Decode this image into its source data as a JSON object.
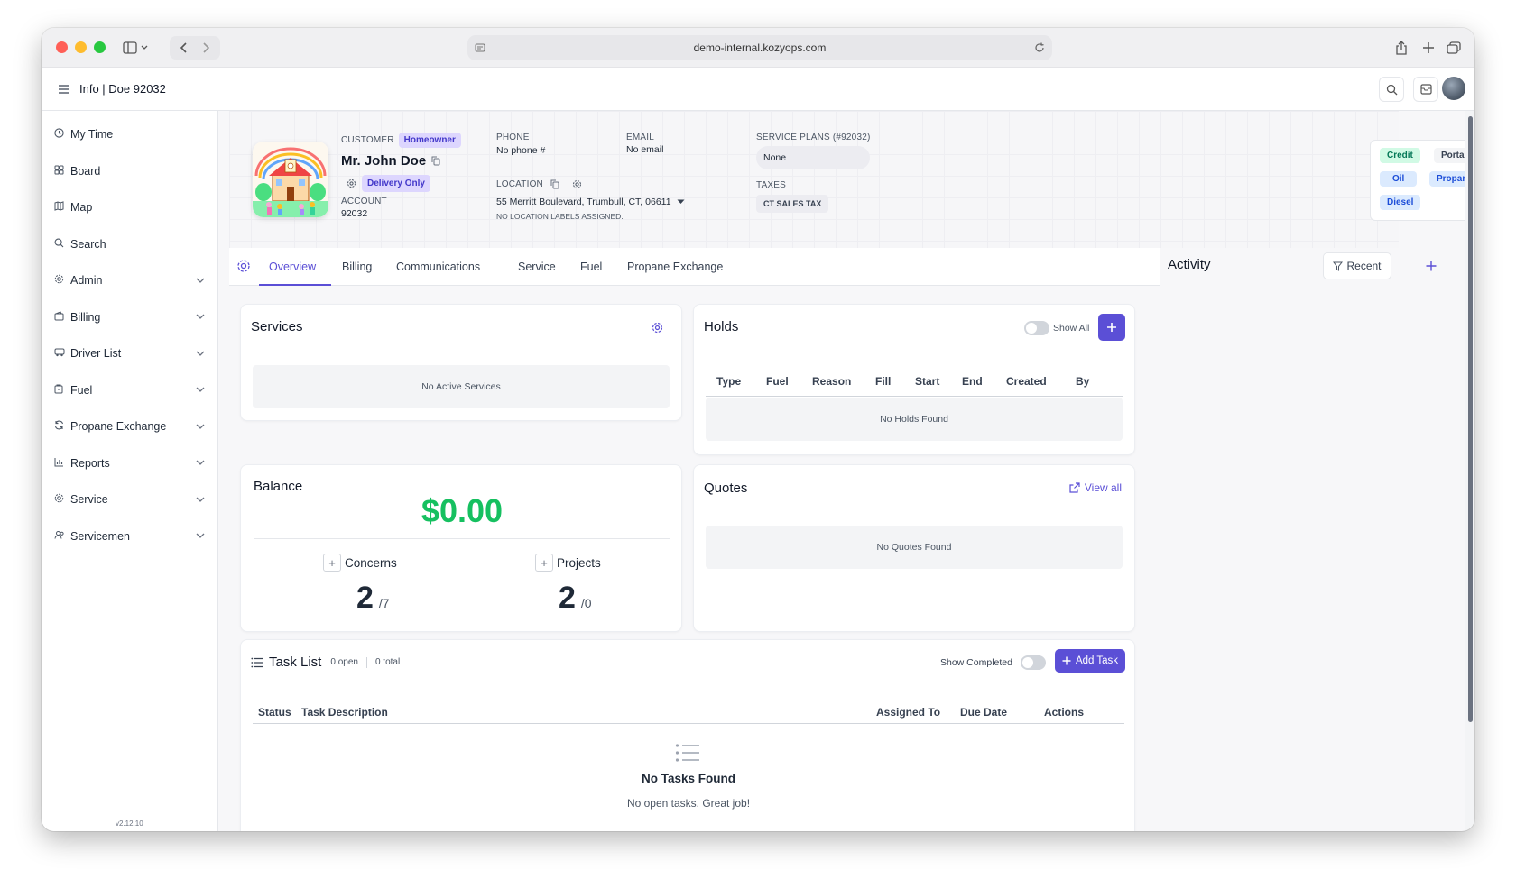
{
  "browser": {
    "url": "demo-internal.kozyops.com"
  },
  "header": {
    "title": "Info | Doe 92032"
  },
  "sidebar": {
    "items": [
      {
        "label": "My Time",
        "icon": "clock-icon",
        "expandable": false
      },
      {
        "label": "Board",
        "icon": "grid-icon",
        "expandable": false
      },
      {
        "label": "Map",
        "icon": "map-icon",
        "expandable": false
      },
      {
        "label": "Search",
        "icon": "search-icon",
        "expandable": false
      },
      {
        "label": "Admin",
        "icon": "gear-icon",
        "expandable": true
      },
      {
        "label": "Billing",
        "icon": "wallet-icon",
        "expandable": true
      },
      {
        "label": "Driver List",
        "icon": "truck-icon",
        "expandable": true
      },
      {
        "label": "Fuel",
        "icon": "fuel-icon",
        "expandable": true
      },
      {
        "label": "Propane Exchange",
        "icon": "refresh-icon",
        "expandable": true
      },
      {
        "label": "Reports",
        "icon": "chart-icon",
        "expandable": true
      },
      {
        "label": "Service",
        "icon": "gear-icon",
        "expandable": true
      },
      {
        "label": "Servicemen",
        "icon": "users-icon",
        "expandable": true
      }
    ],
    "version": "v2.12.10"
  },
  "customer": {
    "label": "CUSTOMER",
    "type_badge": "Homeowner",
    "name": "Mr. John Doe",
    "delivery_badge": "Delivery Only",
    "account_label": "ACCOUNT",
    "account_number": "92032",
    "phone_label": "PHONE",
    "phone_value": "No phone #",
    "email_label": "EMAIL",
    "email_value": "No email",
    "location_label": "LOCATION",
    "location_value": "55 Merritt Boulevard, Trumbull, CT, 06611",
    "location_note": "NO LOCATION LABELS ASSIGNED.",
    "service_plans_label": "SERVICE PLANS (#92032)",
    "service_plans_value": "None",
    "taxes_label": "TAXES",
    "taxes_value": "CT SALES TAX"
  },
  "tags": {
    "credit": "Credit",
    "portal": "Portal",
    "oil": "Oil",
    "propane": "Propane",
    "diesel": "Diesel"
  },
  "tabs": [
    "Overview",
    "Billing",
    "Communications",
    "Service",
    "Fuel",
    "Propane Exchange"
  ],
  "activity": {
    "title": "Activity",
    "filter_label": "Recent"
  },
  "services": {
    "title": "Services",
    "empty": "No Active Services"
  },
  "holds": {
    "title": "Holds",
    "show_all": "Show All",
    "columns": [
      "Type",
      "Fuel",
      "Reason",
      "Fill",
      "Start",
      "End",
      "Created",
      "By"
    ],
    "empty": "No Holds Found"
  },
  "balance": {
    "title": "Balance",
    "amount": "$0.00",
    "concerns_label": "Concerns",
    "concerns_count": "2",
    "concerns_total": "/7",
    "projects_label": "Projects",
    "projects_count": "2",
    "projects_total": "/0"
  },
  "quotes": {
    "title": "Quotes",
    "view_all": "View all",
    "empty": "No Quotes Found"
  },
  "tasks": {
    "title": "Task List",
    "open_count": "0 open",
    "total_count": "0 total",
    "show_completed": "Show Completed",
    "add_task": "Add Task",
    "columns": {
      "status": "Status",
      "description": "Task Description",
      "assigned": "Assigned To",
      "due": "Due Date",
      "actions": "Actions"
    },
    "empty_title": "No Tasks Found",
    "empty_sub": "No open tasks. Great job!"
  },
  "colors": {
    "accent": "#5b4fd6",
    "balance_green": "#16c060",
    "homeowner_bg": "#ddd6fe",
    "credit_bg": "#d1fae5",
    "oil_bg": "#dbeafe"
  }
}
